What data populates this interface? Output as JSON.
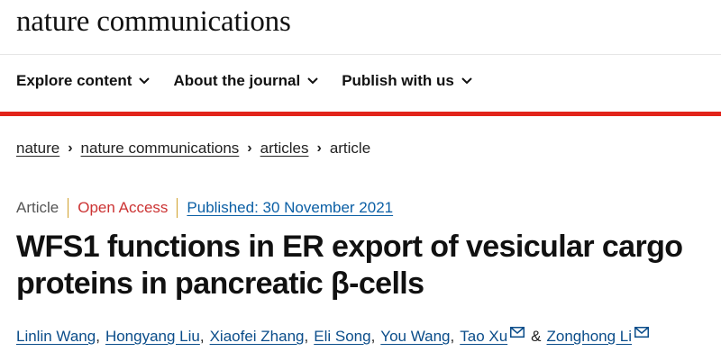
{
  "header": {
    "logo": "nature communications",
    "nav": [
      {
        "label": "Explore content"
      },
      {
        "label": "About the journal"
      },
      {
        "label": "Publish with us"
      }
    ]
  },
  "breadcrumb": {
    "items": [
      "nature",
      "nature communications",
      "articles"
    ],
    "current": "article"
  },
  "article": {
    "type": "Article",
    "access": "Open Access",
    "published": "Published: 30 November 2021",
    "title": "WFS1 functions in ER export of vesicular cargo proteins in pancreatic β-cells",
    "authors": [
      "Linlin Wang",
      "Hongyang Liu",
      "Xiaofei Zhang",
      "Eli Song",
      "You Wang",
      "Tao Xu",
      "Zonghong Li"
    ],
    "author_separator": ",",
    "ampersand": "&"
  },
  "colors": {
    "accent_red": "#e2231a",
    "link_blue": "#0b4d8a",
    "open_access_red": "#cc3333"
  }
}
